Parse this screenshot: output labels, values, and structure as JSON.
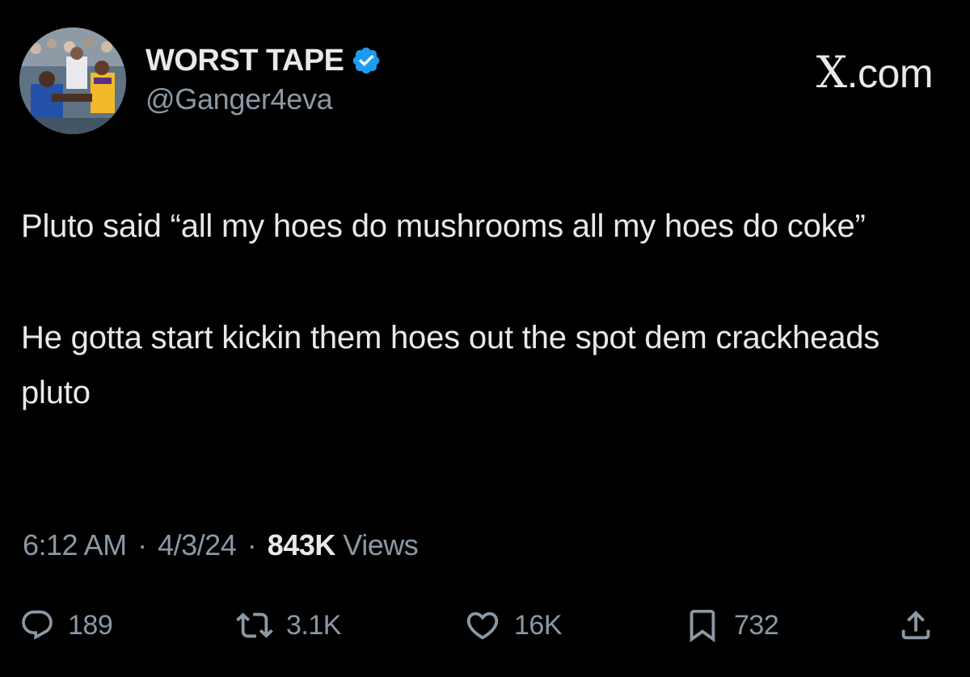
{
  "brand": {
    "logo_text": "X",
    "domain_suffix": ".com"
  },
  "author": {
    "display_name": "WORST TAPE",
    "handle": "@Ganger4eva",
    "verified": true
  },
  "tweet": {
    "paragraphs": [
      "Pluto said “all my hoes do mushrooms all my hoes do coke”",
      "He gotta start kickin them hoes out the spot dem crackheads pluto"
    ]
  },
  "meta": {
    "time": "6:12 AM",
    "date": "4/3/24",
    "separator": "·",
    "views_count": "843K",
    "views_label": "Views"
  },
  "actions": {
    "replies": "189",
    "retweets": "3.1K",
    "likes": "16K",
    "bookmarks": "732"
  },
  "icons": {
    "verified": "verified-badge-icon",
    "reply": "speech-bubble-icon",
    "retweet": "retweet-arrows-icon",
    "like": "heart-icon",
    "bookmark": "bookmark-icon",
    "share": "share-upload-icon"
  },
  "colors": {
    "background": "#000000",
    "text_primary": "#e7e9ea",
    "text_secondary": "#8b98a5",
    "verified_blue": "#1d9bf0"
  }
}
